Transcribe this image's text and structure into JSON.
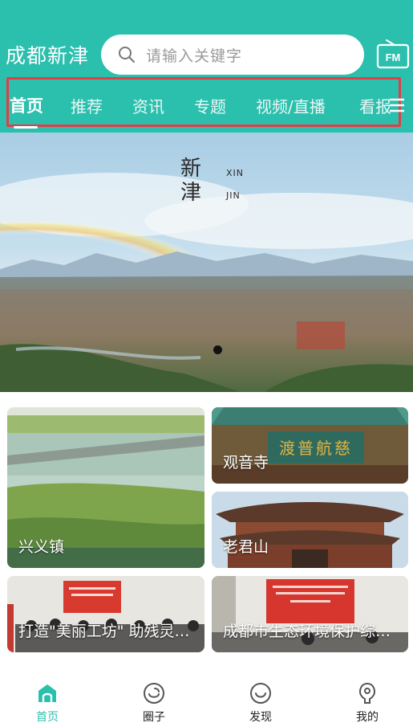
{
  "header": {
    "app_title": "成都新津",
    "search_placeholder": "请输入关键字",
    "fm_label": "FM"
  },
  "tabs": [
    {
      "label": "首页",
      "active": true
    },
    {
      "label": "推荐",
      "active": false
    },
    {
      "label": "资讯",
      "active": false
    },
    {
      "label": "专题",
      "active": false
    },
    {
      "label": "视频/直播",
      "active": false
    },
    {
      "label": "看报",
      "active": false
    }
  ],
  "banner": {
    "title_line1": "新",
    "title_line2": "津",
    "pinyin_line1": "XIN",
    "pinyin_line2": "JIN"
  },
  "cards": {
    "xingyi": "兴义镇",
    "guanyin": "观音寺",
    "laojun": "老君山",
    "news1": "打造\"美丽工坊\" 助残灵…",
    "news2": "成都市生态环境保护综…"
  },
  "bottom_nav": [
    {
      "label": "首页",
      "icon": "home-icon",
      "active": true
    },
    {
      "label": "圈子",
      "icon": "circle-icon",
      "active": false
    },
    {
      "label": "发现",
      "icon": "discover-icon",
      "active": false
    },
    {
      "label": "我的",
      "icon": "profile-icon",
      "active": false
    }
  ],
  "colors": {
    "brand": "#2bbfae",
    "highlight_box": "#e33d45"
  }
}
